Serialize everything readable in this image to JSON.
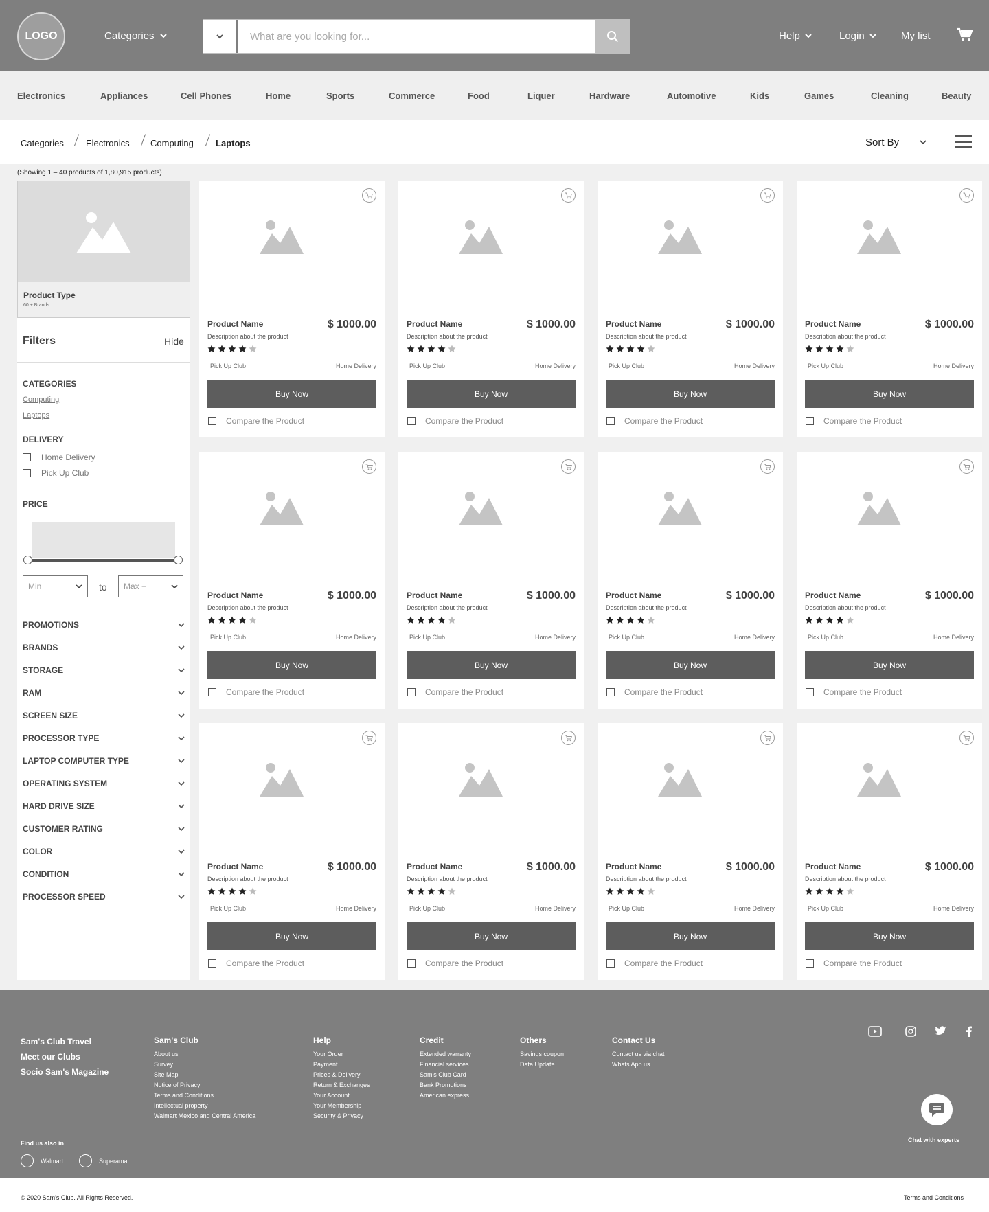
{
  "header": {
    "logo": "LOGO",
    "categories_label": "Categories",
    "search_placeholder": "What are you looking for...",
    "help_label": "Help",
    "login_label": "Login",
    "mylist_label": "My list"
  },
  "nav": {
    "items": [
      "Electronics",
      "Appliances",
      "Cell Phones",
      "Home",
      "Sports",
      "Commerce",
      "Food",
      "Liquer",
      "Hardware",
      "Automotive",
      "Kids",
      "Games",
      "Cleaning",
      "Beauty"
    ]
  },
  "breadcrumb": {
    "items": [
      "Categories",
      "Electronics",
      "Computing",
      "Laptops"
    ]
  },
  "sort_label": "Sort By",
  "showing_text": "(Showing 1 – 40 products of 1,80,915 products)",
  "sidebar": {
    "product_type": "Product Type",
    "product_type_sub": "60 + Brands",
    "filters_title": "Filters",
    "hide_label": "Hide",
    "categories_title": "CATEGORIES",
    "category_links": [
      "Computing",
      "Laptops"
    ],
    "delivery_title": "DELIVERY",
    "delivery_options": [
      "Home Delivery",
      "Pick Up Club"
    ],
    "price_title": "PRICE",
    "price_min": "Min",
    "price_to": "to",
    "price_max": "Max +",
    "accordions": [
      "PROMOTIONS",
      "BRANDS",
      "STORAGE",
      "RAM",
      "SCREEN SIZE",
      "PROCESSOR TYPE",
      "LAPTOP COMPUTER TYPE",
      "OPERATING SYSTEM",
      "HARD DRIVE SIZE",
      "CUSTOMER RATING",
      "COLOR",
      "CONDITION",
      "PROCESSOR SPEED"
    ]
  },
  "products": [
    {
      "name": "Product Name",
      "price": "$ 1000.00",
      "description": "Description about the product",
      "rating": 4,
      "option1": "Pick Up Club",
      "option2": "Home Delivery",
      "buy_label": "Buy Now",
      "compare_label": "Compare the Product"
    },
    {
      "name": "Product Name",
      "price": "$ 1000.00",
      "description": "Description about the product",
      "rating": 4,
      "option1": "Pick Up Club",
      "option2": "Home Delivery",
      "buy_label": "Buy Now",
      "compare_label": "Compare the Product"
    },
    {
      "name": "Product Name",
      "price": "$ 1000.00",
      "description": "Description about the product",
      "rating": 4,
      "option1": "Pick Up Club",
      "option2": "Home Delivery",
      "buy_label": "Buy Now",
      "compare_label": "Compare the Product"
    },
    {
      "name": "Product Name",
      "price": "$ 1000.00",
      "description": "Description about the product",
      "rating": 4,
      "option1": "Pick Up Club",
      "option2": "Home Delivery",
      "buy_label": "Buy Now",
      "compare_label": "Compare the Product"
    },
    {
      "name": "Product Name",
      "price": "$ 1000.00",
      "description": "Description about the product",
      "rating": 4,
      "option1": "Pick Up Club",
      "option2": "Home Delivery",
      "buy_label": "Buy Now",
      "compare_label": "Compare the Product"
    },
    {
      "name": "Product Name",
      "price": "$ 1000.00",
      "description": "Description about the product",
      "rating": 4,
      "option1": "Pick Up Club",
      "option2": "Home Delivery",
      "buy_label": "Buy Now",
      "compare_label": "Compare the Product"
    },
    {
      "name": "Product Name",
      "price": "$ 1000.00",
      "description": "Description about the product",
      "rating": 4,
      "option1": "Pick Up Club",
      "option2": "Home Delivery",
      "buy_label": "Buy Now",
      "compare_label": "Compare the Product"
    },
    {
      "name": "Product Name",
      "price": "$ 1000.00",
      "description": "Description about the product",
      "rating": 4,
      "option1": "Pick Up Club",
      "option2": "Home Delivery",
      "buy_label": "Buy Now",
      "compare_label": "Compare the Product"
    },
    {
      "name": "Product Name",
      "price": "$ 1000.00",
      "description": "Description about the product",
      "rating": 4,
      "option1": "Pick Up Club",
      "option2": "Home Delivery",
      "buy_label": "Buy Now",
      "compare_label": "Compare the Product"
    },
    {
      "name": "Product Name",
      "price": "$ 1000.00",
      "description": "Description about the product",
      "rating": 4,
      "option1": "Pick Up Club",
      "option2": "Home Delivery",
      "buy_label": "Buy Now",
      "compare_label": "Compare the Product"
    },
    {
      "name": "Product Name",
      "price": "$ 1000.00",
      "description": "Description about the product",
      "rating": 4,
      "option1": "Pick Up Club",
      "option2": "Home Delivery",
      "buy_label": "Buy Now",
      "compare_label": "Compare the Product"
    },
    {
      "name": "Product Name",
      "price": "$ 1000.00",
      "description": "Description about the product",
      "rating": 4,
      "option1": "Pick Up Club",
      "option2": "Home Delivery",
      "buy_label": "Buy Now",
      "compare_label": "Compare the Product"
    }
  ],
  "footer": {
    "main_links": [
      "Sam's Club Travel",
      "Meet our Clubs",
      "Socio Sam's Magazine"
    ],
    "columns": [
      {
        "title": "Sam's Club",
        "items": [
          "About us",
          "Survey",
          "Site Map",
          "Notice of Privacy",
          "Terms and Conditions",
          "Intellectual property",
          "Walmart Mexico and Central America"
        ]
      },
      {
        "title": "Help",
        "items": [
          "Your Order",
          "Payment",
          "Prices & Delivery",
          "Return & Exchanges",
          "Your Account",
          "Your Membership",
          "Security & Privacy"
        ]
      },
      {
        "title": "Credit",
        "items": [
          "Extended warranty",
          "Financial services",
          "Sam's Club Card",
          "Bank Promotions",
          "American express"
        ]
      },
      {
        "title": "Others",
        "items": [
          "Savings coupon",
          "Data Update"
        ]
      },
      {
        "title": "Contact Us",
        "items": [
          "Contact us via chat",
          "Whats App us"
        ]
      }
    ],
    "find_title": "Find us also in",
    "find_items": [
      "Walmart",
      "Superama"
    ],
    "chat_label": "Chat with experts",
    "copyright": "© 2020 Sam's Club. All Rights Reserved.",
    "terms": "Terms and Conditions"
  }
}
